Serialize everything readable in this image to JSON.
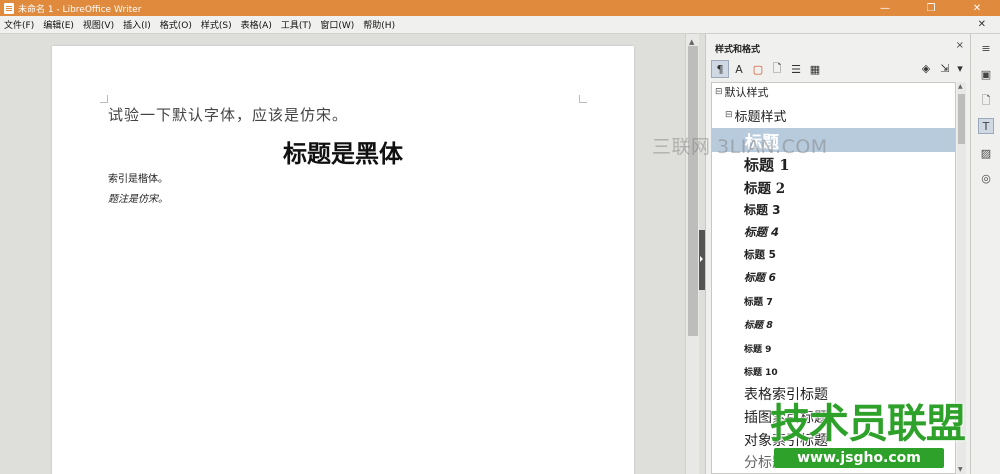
{
  "window": {
    "title": "未命名 1 - LibreOffice Writer",
    "controls": {
      "minimize": "—",
      "restore": "❐",
      "close": "✕"
    }
  },
  "menubar": {
    "items": [
      "文件(F)",
      "编辑(E)",
      "视图(V)",
      "插入(I)",
      "格式(O)",
      "样式(S)",
      "表格(A)",
      "工具(T)",
      "窗口(W)",
      "帮助(H)"
    ],
    "close_doc": "✕"
  },
  "document": {
    "paragraphs": {
      "default": "试验一下默认字体，应该是仿宋。",
      "heading": "标题是黑体",
      "index": "索引是楷体。",
      "caption": "题注是仿宋。"
    }
  },
  "sidebar": {
    "title": "样式和格式",
    "close": "×",
    "toolbar": {
      "paragraph_styles": "¶",
      "character_styles": "A",
      "frame_styles": "▢",
      "page_styles": "🗋",
      "list_styles": "☰",
      "table_styles": "▦",
      "fill_format": "◈",
      "new_style": "⇲",
      "menu": "▾"
    },
    "tree": {
      "toggle_open": "⊟",
      "root": "默认样式",
      "group": "标题样式",
      "selected": "标题",
      "items": [
        "标题 1",
        "标题 2",
        "标题 3",
        "标题 4",
        "标题 5",
        "标题 6",
        "标题 7",
        "标题 8",
        "标题 9",
        "标题 10",
        "表格索引标题",
        "插图索引标题",
        "对象索引标题",
        "分标题"
      ]
    }
  },
  "deck": {
    "tabs": {
      "properties": "≡",
      "page": "▣",
      "styles": "🗋",
      "gallery": "T",
      "image": "▨",
      "navigator": "◎"
    }
  },
  "watermarks": {
    "site": "三联网 3LIAN.COM",
    "logo": "技术员联盟",
    "url": "www.jsgho.com"
  }
}
